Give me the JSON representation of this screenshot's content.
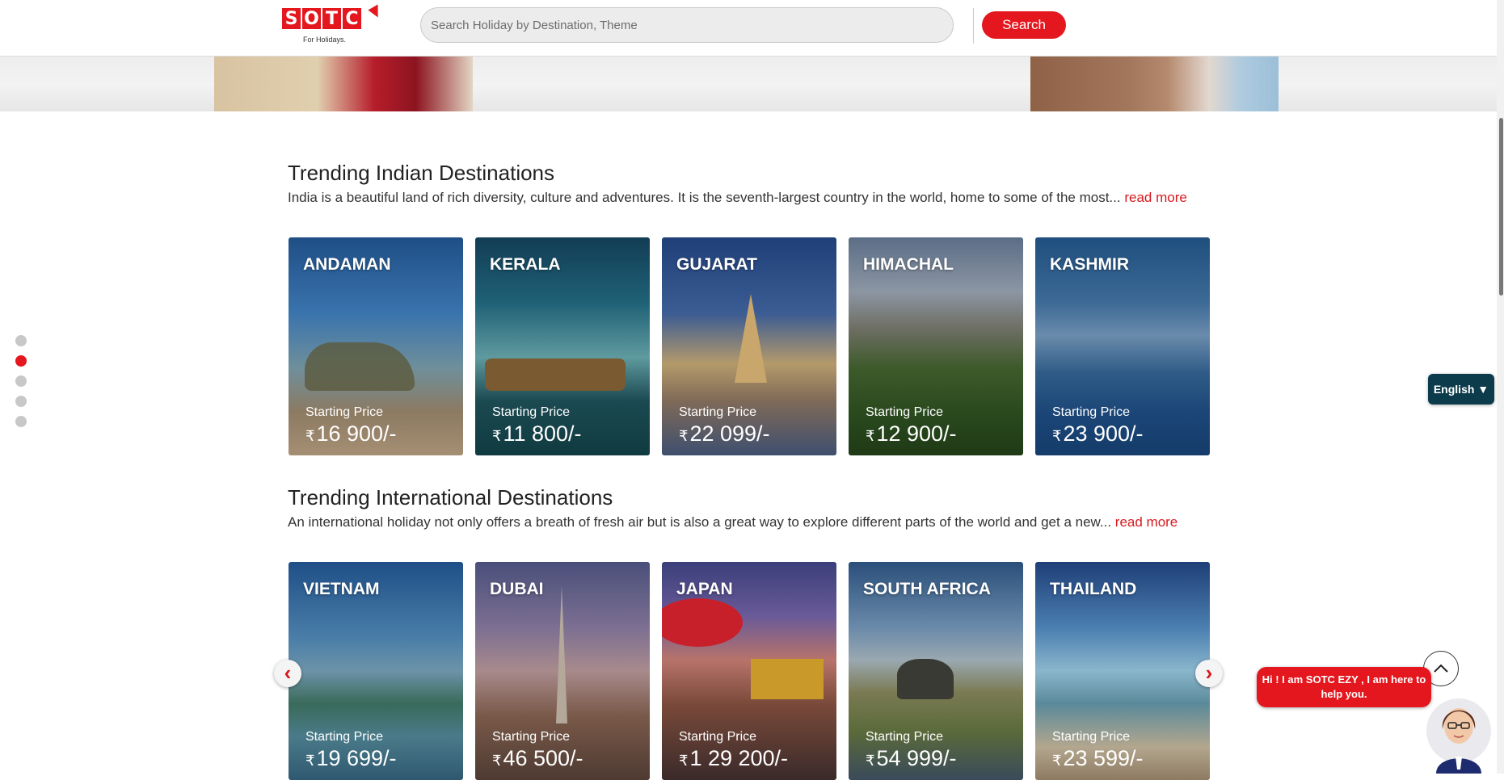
{
  "brand": {
    "logo_letters": [
      "S",
      "O",
      "T",
      "C"
    ],
    "tagline": "For Holidays."
  },
  "search": {
    "placeholder": "Search Holiday by Destination, Theme",
    "button_label": "Search"
  },
  "side_nav": {
    "dots": 5,
    "active_index": 1
  },
  "currency_symbol": "₹",
  "indian": {
    "title": "Trending Indian Destinations",
    "description": "India is a beautiful land of rich diversity, culture and adventures. It is the seventh-largest country in the world, home to some of the most...",
    "read_more": "read more",
    "cards": [
      {
        "name": "ANDAMAN",
        "label": "Starting Price",
        "price": "16 900/-"
      },
      {
        "name": "KERALA",
        "label": "Starting Price",
        "price": "11 800/-"
      },
      {
        "name": "GUJARAT",
        "label": "Starting Price",
        "price": "22 099/-"
      },
      {
        "name": "HIMACHAL",
        "label": "Starting Price",
        "price": "12 900/-"
      },
      {
        "name": "KASHMIR",
        "label": "Starting Price",
        "price": "23 900/-"
      }
    ]
  },
  "international": {
    "title": "Trending International Destinations",
    "description": "An international holiday not only offers a breath of fresh air but is also a great way to explore different parts of the world and get a new...",
    "read_more": "read more",
    "cards": [
      {
        "name": "VIETNAM",
        "label": "Starting Price",
        "price": "19 699/-"
      },
      {
        "name": "DUBAI",
        "label": "Starting Price",
        "price": "46 500/-"
      },
      {
        "name": "JAPAN",
        "label": "Starting Price",
        "price": "1 29 200/-"
      },
      {
        "name": "SOUTH AFRICA",
        "label": "Starting Price",
        "price": "54 999/-"
      },
      {
        "name": "THAILAND",
        "label": "Starting Price",
        "price": "23 599/-"
      }
    ]
  },
  "language": {
    "label": "English ▼"
  },
  "chat": {
    "message": "Hi ! I am SOTC EZY , I am here to help you."
  },
  "colors": {
    "brand_red": "#e5171e",
    "language_bg": "#0c3b4c",
    "link_red": "#d8191f"
  }
}
